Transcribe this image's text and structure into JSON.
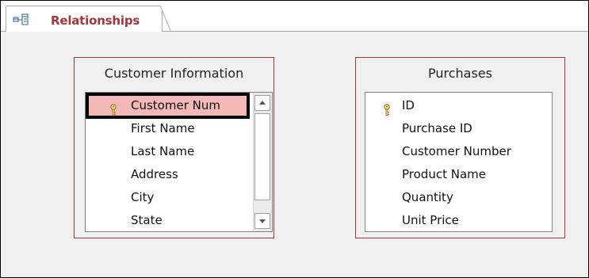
{
  "tab": {
    "label": "Relationships",
    "icon": "relationships-icon"
  },
  "colors": {
    "accent": "#a4373a",
    "selected_row": "#f4b8b8"
  },
  "tables": [
    {
      "title": "Customer Information",
      "fields": [
        {
          "label": "Customer Num",
          "key": true,
          "selected": true
        },
        {
          "label": "First Name"
        },
        {
          "label": "Last Name"
        },
        {
          "label": "Address"
        },
        {
          "label": "City"
        },
        {
          "label": "State"
        }
      ],
      "scrollbar": true
    },
    {
      "title": "Purchases",
      "fields": [
        {
          "label": "ID",
          "key": true
        },
        {
          "label": "Purchase ID"
        },
        {
          "label": "Customer Number"
        },
        {
          "label": "Product Name"
        },
        {
          "label": "Quantity"
        },
        {
          "label": "Unit Price"
        }
      ],
      "scrollbar": false
    }
  ]
}
